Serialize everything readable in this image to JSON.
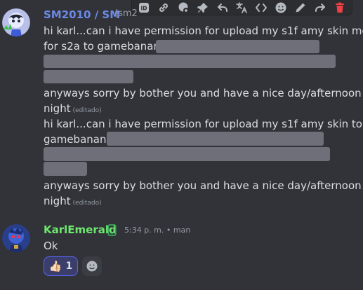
{
  "message1": {
    "author_name": "SM2010 / SM",
    "author_tag": "(sm2",
    "line1": "hi karl...can i have permission for upload my s1f amy skin mod",
    "line2": "for s2a to gamebanana",
    "line3": "anyways sorry by bother you and have a nice day/afternoon or",
    "line4": "night",
    "edited": "(editado)",
    "line5": "hi karl...can i have permission for upload my s1f amy skin to",
    "line6": "gamebanana",
    "line7": "anyways sorry by bother you and have a nice day/afternoon or",
    "line8": "night",
    "edited2": "(editado)"
  },
  "message2": {
    "author_name": "KarlEmerald",
    "timestamp": "5:34 p. m. • man",
    "text": "Ok",
    "reaction_emoji": "👍🏻",
    "reaction_count": "1"
  },
  "toolbar_icons": [
    "id-icon",
    "link-icon",
    "reply-history-icon",
    "pin-icon",
    "reply-icon",
    "translate-icon",
    "code-icon",
    "emoji-icon",
    "edit-icon",
    "forward-icon",
    "delete-icon"
  ],
  "colors": {
    "accent": "#5865f2",
    "username_blue": "#6b8ae8",
    "username_green": "#6ee86e",
    "delete_red": "#f23f43"
  }
}
